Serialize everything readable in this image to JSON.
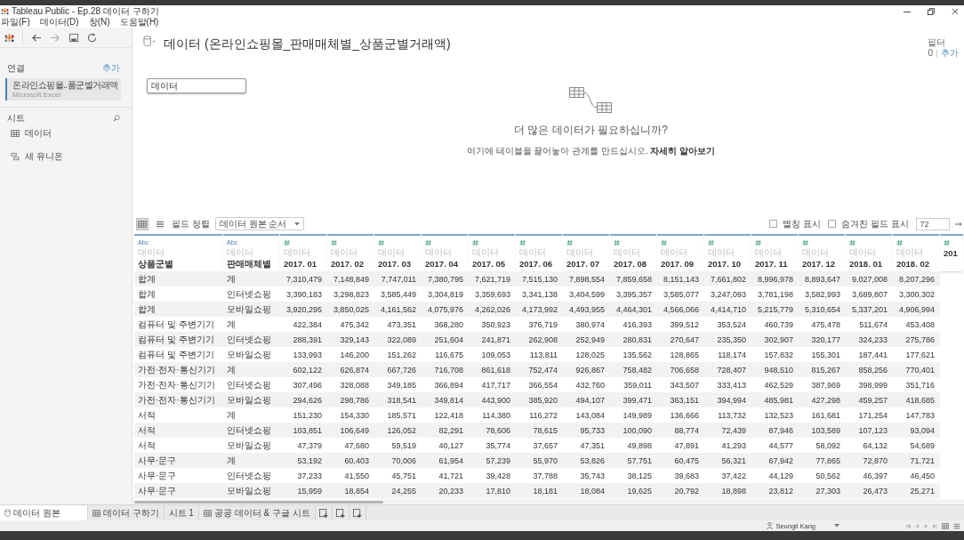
{
  "window": {
    "title": "Tableau Public - Ep.28 데이터 구하기"
  },
  "menu": [
    "파일(F)",
    "데이터(D)",
    "창(N)",
    "도움말(H)"
  ],
  "sidebar": {
    "connections_label": "연결",
    "connections_add": "추가",
    "connections": [
      {
        "name": "온라인쇼핑몰..품군별거래액",
        "type": "Microsoft Excel",
        "selected": true
      }
    ],
    "sheets_label": "시트",
    "sheets": [
      {
        "name": "데이터"
      }
    ],
    "new_union": "새 유니온"
  },
  "datasource": {
    "title": "데이터 (온라인쇼핑몰_판매매체별_상품군별거래액)",
    "filter_label": "필터",
    "filter_count": "0",
    "filter_add": "추가"
  },
  "canvas": {
    "tables": [
      {
        "name": "데이터"
      }
    ],
    "prompt_title": "더 많은 데이터가 필요하십니까?",
    "prompt_text": "여기에 테이블을 끌어놓아 관계를 만드십시오.",
    "prompt_link": "자세히 알아보기"
  },
  "grid_toolbar": {
    "view_modes": [
      {
        "kind": "grid",
        "selected": true
      },
      {
        "kind": "list",
        "selected": false
      }
    ],
    "sort_label": "필드 정렬",
    "sort_value": "데이터 원본 순서",
    "options": [
      {
        "label": "별칭 표시",
        "checked": false
      },
      {
        "label": "숨겨진 필드 표시",
        "checked": false
      }
    ],
    "rows_value": "72",
    "go": "⇒"
  },
  "table": {
    "columns": [
      {
        "kind": "text",
        "type_label": "Abc",
        "source": "데이터",
        "name": "상품군별"
      },
      {
        "kind": "text",
        "type_label": "Abc",
        "source": "데이터",
        "name": "판매매체별"
      },
      {
        "kind": "number",
        "source": "데이터",
        "name": "2017. 01"
      },
      {
        "kind": "number",
        "source": "데이터",
        "name": "2017. 02"
      },
      {
        "kind": "number",
        "source": "데이터",
        "name": "2017. 03"
      },
      {
        "kind": "number",
        "source": "데이터",
        "name": "2017. 04"
      },
      {
        "kind": "number",
        "source": "데이터",
        "name": "2017. 05"
      },
      {
        "kind": "number",
        "source": "데이터",
        "name": "2017. 06"
      },
      {
        "kind": "number",
        "source": "데이터",
        "name": "2017. 07"
      },
      {
        "kind": "number",
        "source": "데이터",
        "name": "2017. 08"
      },
      {
        "kind": "number",
        "source": "데이터",
        "name": "2017. 09"
      },
      {
        "kind": "number",
        "source": "데이터",
        "name": "2017. 10"
      },
      {
        "kind": "number",
        "source": "데이터",
        "name": "2017. 11"
      },
      {
        "kind": "number",
        "source": "데이터",
        "name": "2017. 12"
      },
      {
        "kind": "number",
        "source": "데이터",
        "name": "2018. 01"
      },
      {
        "kind": "number",
        "source": "데이터",
        "name": "2018. 02"
      },
      {
        "kind": "number",
        "name": "201"
      }
    ],
    "rows": [
      {
        "cells": [
          "합계",
          "계",
          "7,310,479",
          "7,148,849",
          "7,747,011",
          "7,380,795",
          "7,621,719",
          "7,515,130",
          "7,898,554",
          "7,859,658",
          "8,151,143",
          "7,661,802",
          "8,996,978",
          "8,893,647",
          "9,027,008",
          "8,207,296"
        ]
      },
      {
        "cells": [
          "합계",
          "인터넷쇼핑",
          "3,390,183",
          "3,298,823",
          "3,585,449",
          "3,304,819",
          "3,359,693",
          "3,341,138",
          "3,404,599",
          "3,395,357",
          "3,585,077",
          "3,247,093",
          "3,781,198",
          "3,582,993",
          "3,689,807",
          "3,300,302"
        ]
      },
      {
        "cells": [
          "합계",
          "모바일쇼핑",
          "3,920,295",
          "3,850,025",
          "4,161,562",
          "4,075,976",
          "4,262,026",
          "4,173,992",
          "4,493,955",
          "4,464,301",
          "4,566,066",
          "4,414,710",
          "5,215,779",
          "5,310,654",
          "5,337,201",
          "4,906,994"
        ]
      },
      {
        "cells": [
          "컴퓨터 및 주변기기",
          "계",
          "422,384",
          "475,342",
          "473,351",
          "368,280",
          "350,923",
          "376,719",
          "380,974",
          "416,393",
          "399,512",
          "353,524",
          "460,739",
          "475,478",
          "511,674",
          "453,408"
        ]
      },
      {
        "cells": [
          "컴퓨터 및 주변기기",
          "인터넷쇼핑",
          "288,391",
          "329,143",
          "322,089",
          "251,604",
          "241,871",
          "262,908",
          "252,949",
          "280,831",
          "270,647",
          "235,350",
          "302,907",
          "320,177",
          "324,233",
          "275,786"
        ]
      },
      {
        "cells": [
          "컴퓨터 및 주변기기",
          "모바일쇼핑",
          "133,993",
          "146,200",
          "151,262",
          "116,675",
          "109,053",
          "113,811",
          "128,025",
          "135,562",
          "128,865",
          "118,174",
          "157,832",
          "155,301",
          "187,441",
          "177,621"
        ]
      },
      {
        "cells": [
          "가전·전자·통신기기",
          "계",
          "602,122",
          "626,874",
          "667,726",
          "716,708",
          "861,618",
          "752,474",
          "926,867",
          "758,482",
          "706,658",
          "728,407",
          "948,510",
          "815,267",
          "858,256",
          "770,401"
        ]
      },
      {
        "cells": [
          "가전·전자·통신기기",
          "인터넷쇼핑",
          "307,496",
          "328,088",
          "349,185",
          "366,894",
          "417,717",
          "366,554",
          "432,760",
          "359,011",
          "343,507",
          "333,413",
          "462,529",
          "387,969",
          "398,999",
          "351,716"
        ]
      },
      {
        "cells": [
          "가전·전자·통신기기",
          "모바일쇼핑",
          "294,626",
          "298,786",
          "318,541",
          "349,814",
          "443,900",
          "385,920",
          "494,107",
          "399,471",
          "363,151",
          "394,994",
          "485,981",
          "427,298",
          "459,257",
          "418,685"
        ]
      },
      {
        "cells": [
          "서적",
          "계",
          "151,230",
          "154,330",
          "185,571",
          "122,418",
          "114,380",
          "116,272",
          "143,084",
          "149,989",
          "136,666",
          "113,732",
          "132,523",
          "161,681",
          "171,254",
          "147,783"
        ]
      },
      {
        "cells": [
          "서적",
          "인터넷쇼핑",
          "103,851",
          "106,649",
          "126,052",
          "82,291",
          "78,606",
          "78,615",
          "95,733",
          "100,090",
          "88,774",
          "72,439",
          "87,946",
          "103,589",
          "107,123",
          "93,094"
        ]
      },
      {
        "cells": [
          "서적",
          "모바일쇼핑",
          "47,379",
          "47,680",
          "59,519",
          "40,127",
          "35,774",
          "37,657",
          "47,351",
          "49,898",
          "47,891",
          "41,293",
          "44,577",
          "58,092",
          "64,132",
          "54,689"
        ]
      },
      {
        "cells": [
          "사무·문구",
          "계",
          "53,192",
          "60,403",
          "70,006",
          "61,954",
          "57,239",
          "55,970",
          "53,826",
          "57,751",
          "60,475",
          "56,321",
          "67,942",
          "77,865",
          "72,870",
          "71,721"
        ]
      },
      {
        "cells": [
          "사무·문구",
          "인터넷쇼핑",
          "37,233",
          "41,550",
          "45,751",
          "41,721",
          "39,428",
          "37,788",
          "35,743",
          "38,125",
          "39,683",
          "37,422",
          "44,129",
          "50,562",
          "46,397",
          "46,450"
        ]
      },
      {
        "cells": [
          "사무·문구",
          "모바일쇼핑",
          "15,959",
          "18,854",
          "24,255",
          "20,233",
          "17,810",
          "18,181",
          "18,084",
          "19,625",
          "20,792",
          "18,898",
          "23,812",
          "27,303",
          "26,473",
          "25,271"
        ]
      }
    ]
  },
  "sheet_tabs": [
    {
      "label": "데이터 원본",
      "kind": "datasource",
      "selected": true
    },
    {
      "label": "데이터 구하기",
      "kind": "dashboard",
      "selected": false
    },
    {
      "label": "시트 1",
      "kind": "sheet",
      "selected": false
    },
    {
      "label": "공공 데이터 & 구글 시트",
      "kind": "dashboard",
      "selected": false
    }
  ],
  "status_bar": {
    "user": "Seungil Kang"
  }
}
